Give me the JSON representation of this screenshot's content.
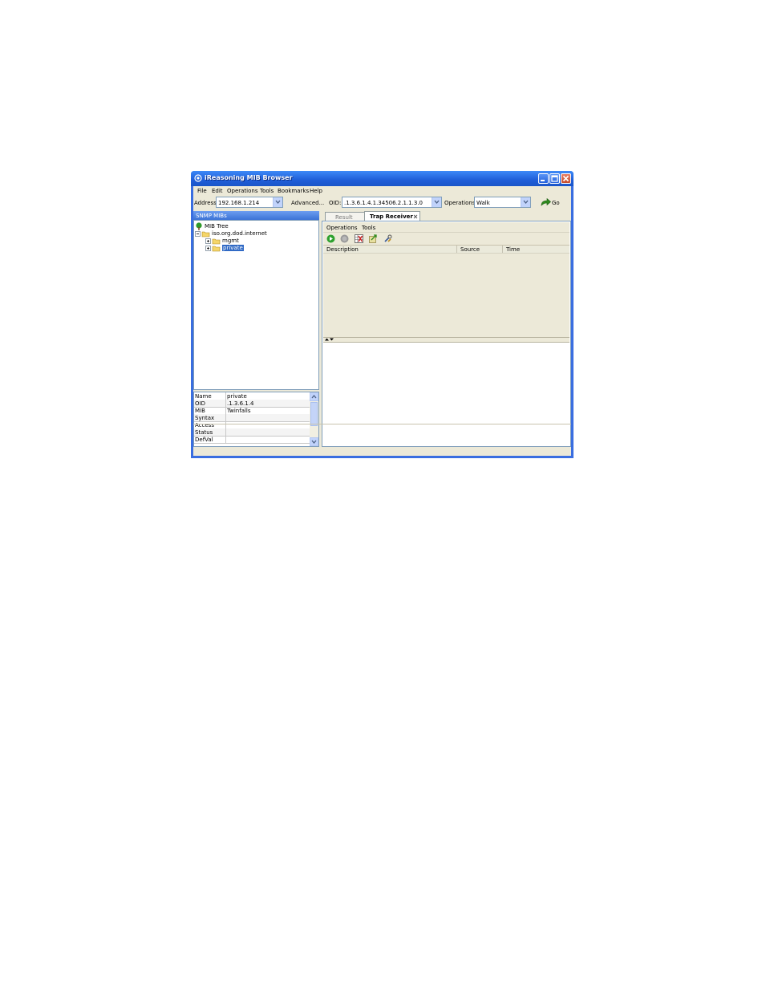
{
  "window": {
    "title": "iReasoning MIB Browser"
  },
  "menu": [
    "File",
    "Edit",
    "Operations",
    "Tools",
    "Bookmarks",
    "Help"
  ],
  "address_bar": {
    "address_label": "Address:",
    "address_value": "192.168.1.214",
    "advanced_label": "Advanced...",
    "oid_label": "OID:",
    "oid_value": ".1.3.6.1.4.1.34506.2.1.1.3.0",
    "operations_label": "Operations:",
    "operations_value": "Walk",
    "go_label": "Go"
  },
  "left_panel": {
    "header": "SNMP MIBs",
    "tree": {
      "root": "MIB Tree",
      "node": "iso.org.dod.internet",
      "children": [
        "mgmt",
        "private"
      ]
    },
    "properties": [
      {
        "key": "Name",
        "value": "private"
      },
      {
        "key": "OID",
        "value": ".1.3.6.1.4"
      },
      {
        "key": "MIB",
        "value": "Twinfalls"
      },
      {
        "key": "Syntax",
        "value": ""
      },
      {
        "key": "Access",
        "value": ""
      },
      {
        "key": "Status",
        "value": ""
      },
      {
        "key": "DefVal",
        "value": ""
      }
    ]
  },
  "tabs": [
    {
      "label": "Result Table",
      "active": false
    },
    {
      "label": "Trap Receiver",
      "active": true
    }
  ],
  "trap_receiver": {
    "menu": [
      "Operations",
      "Tools"
    ],
    "columns": [
      "Description",
      "Source",
      "Time"
    ]
  },
  "colors": {
    "titlebar": "#1f5ed8",
    "client_bg": "#ece9d8",
    "selection": "#316ac5"
  }
}
